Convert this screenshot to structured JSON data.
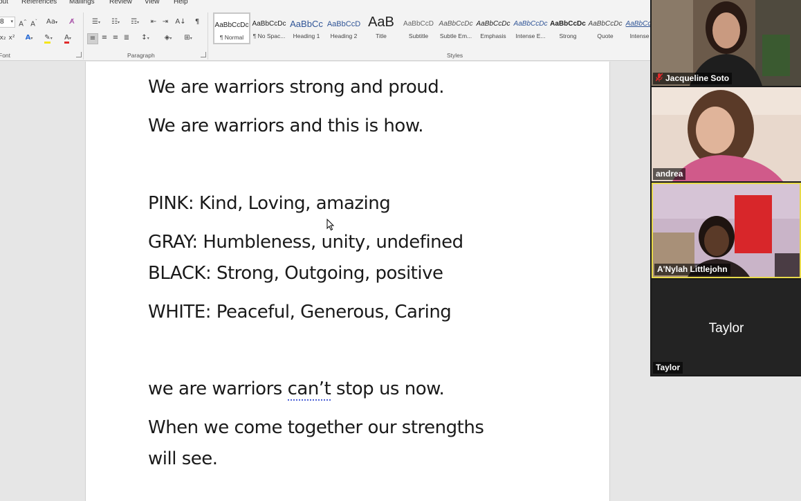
{
  "ribbon": {
    "tabs": [
      "out",
      "References",
      "Mailings",
      "Review",
      "View",
      "Help"
    ],
    "groups": {
      "font": "Font",
      "paragraph": "Paragraph",
      "styles": "Styles"
    },
    "font_size_value": "8",
    "font_buttons": {
      "grow": "A^",
      "shrink": "Aˇ",
      "change_case": "Aa",
      "clear": "A",
      "subscript": "x₂",
      "superscript": "x²",
      "text_effects": "A",
      "highlight": "ab",
      "font_color": "A"
    },
    "paragraph_buttons": {
      "show_marks": "¶",
      "sort": "A↓"
    },
    "styles": [
      {
        "preview": "AaBbCcDc",
        "name": "¶ Normal"
      },
      {
        "preview": "AaBbCcDc",
        "name": "¶ No Spac..."
      },
      {
        "preview": "AaBbCc",
        "name": "Heading 1"
      },
      {
        "preview": "AaBbCcD",
        "name": "Heading 2"
      },
      {
        "preview": "AaB",
        "name": "Title"
      },
      {
        "preview": "AaBbCcD",
        "name": "Subtitle"
      },
      {
        "preview": "AaBbCcDc",
        "name": "Subtle Em..."
      },
      {
        "preview": "AaBbCcDc",
        "name": "Emphasis"
      },
      {
        "preview": "AaBbCcDc",
        "name": "Intense E..."
      },
      {
        "preview": "AaBbCcDc",
        "name": "Strong"
      },
      {
        "preview": "AaBbCcDc",
        "name": "Quote"
      },
      {
        "preview": "AaBbCcDc",
        "name": "Intense Q"
      }
    ]
  },
  "document": {
    "line1": "We are warriors strong and proud.",
    "line2": "We are warriors and this is how.",
    "pink": "PINK: Kind, Loving, amazing",
    "gray": "GRAY: Humbleness, unity, undefined",
    "black": "BLACK: Strong, Outgoing, positive",
    "white": "WHITE: Peaceful, Generous, Caring",
    "line_we_pre": "we are warriors ",
    "line_we_flag": "can’t",
    "line_we_post": " stop us now.",
    "line_when1": "When we come together our strengths",
    "line_when2": "will see."
  },
  "participants": [
    {
      "name": "Jacqueline Soto",
      "muted": true
    },
    {
      "name": "andrea",
      "muted": false
    },
    {
      "name": "A'Nylah Littlejohn",
      "muted": false,
      "active_speaker": true
    },
    {
      "name": "Taylor",
      "muted": false,
      "video": false
    }
  ],
  "colors": {
    "active_speaker_border": "#e8d94a",
    "mute_red": "#e02b2b",
    "spell_squiggle": "#4a5fd6"
  }
}
